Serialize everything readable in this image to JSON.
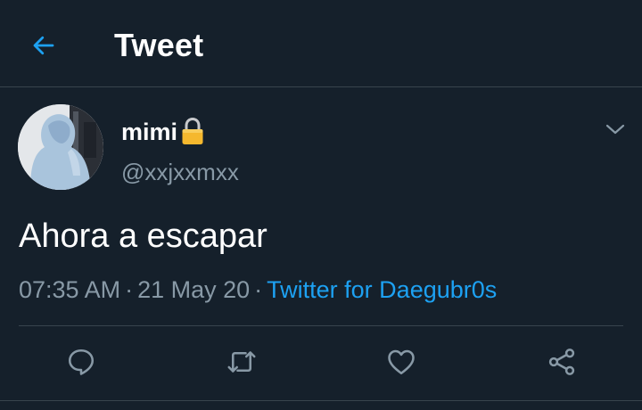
{
  "header": {
    "title": "Tweet",
    "back_icon": "arrow-left-icon",
    "accent_color": "#1da1f2"
  },
  "tweet": {
    "display_name": "mimi",
    "lock_icon": "lock-icon",
    "username": "@xxjxxmxx",
    "text": "Ahora a escapar",
    "time": "07:35 AM",
    "date": "21 May 20",
    "separator": "·",
    "source": "Twitter for Daegubr0s"
  },
  "actions": [
    {
      "name": "reply",
      "icon": "reply-icon"
    },
    {
      "name": "retweet",
      "icon": "retweet-icon"
    },
    {
      "name": "like",
      "icon": "heart-icon"
    },
    {
      "name": "share",
      "icon": "share-icon"
    }
  ],
  "colors": {
    "background": "#15202b",
    "secondary_text": "#8899a6",
    "divider": "#38444d"
  }
}
